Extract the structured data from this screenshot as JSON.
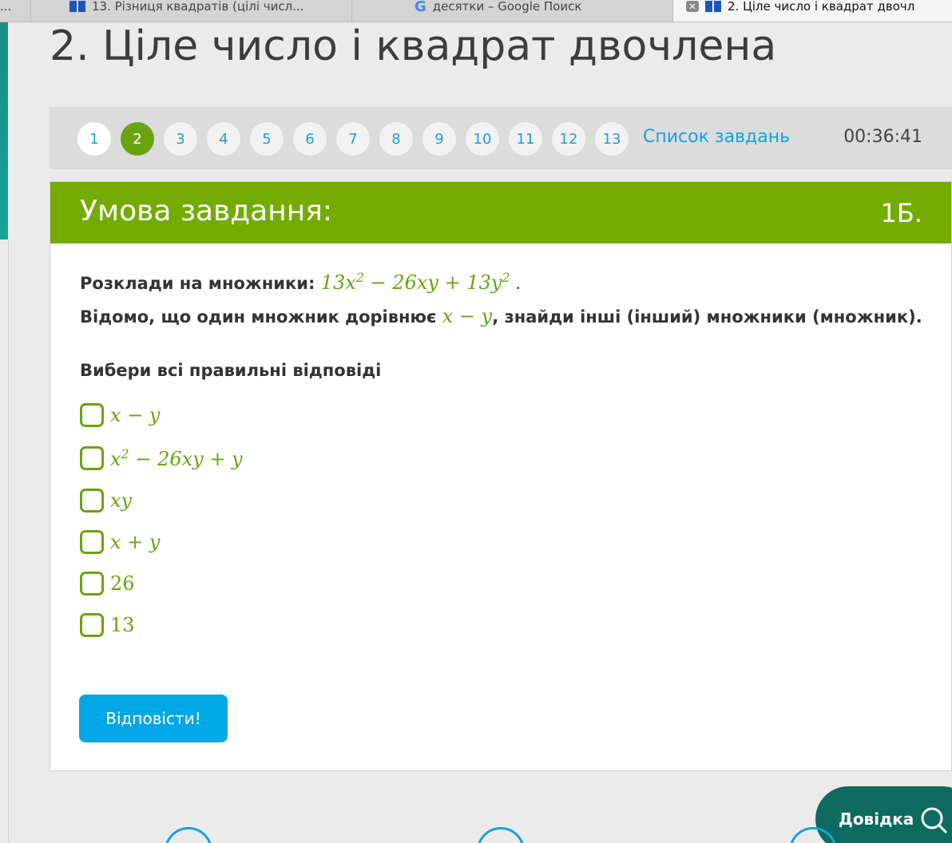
{
  "browser": {
    "tabs": [
      {
        "label": "..."
      },
      {
        "label": "13. Різниця квадратів (цілі числ..."
      },
      {
        "label": "десятки – Google Поиск",
        "icon_label": "G"
      },
      {
        "label": "2. Ціле число і квадрат двочл",
        "close_label": "✕"
      }
    ]
  },
  "page": {
    "title": "2. Ціле число і квадрат двочлена"
  },
  "nav": {
    "numbers": [
      "1",
      "2",
      "3",
      "4",
      "5",
      "6",
      "7",
      "8",
      "9",
      "10",
      "11",
      "12",
      "13"
    ],
    "active": "2",
    "task_list_label": "Список завдань",
    "timer": "00:36:41"
  },
  "task": {
    "header": "Умова завдання:",
    "points": "1Б.",
    "q1_text": "Розклади на множники: ",
    "q1_expr_part1": "13x",
    "q1_sup1": "2",
    "q1_expr_part2": " − 26xy + 13y",
    "q1_sup2": "2",
    "q1_end": " .",
    "q2_text": "Відомо, що один множник дорівнює ",
    "q2_expr": "x − y",
    "q2_end": ", знайди інші (інший) множники (множник).",
    "prompt": "Вибери всі правильні відповіді",
    "options": [
      {
        "text": "x − y"
      },
      {
        "text_part1": "x",
        "sup": "2",
        "text_part2": " − 26xy + y"
      },
      {
        "text": "xy"
      },
      {
        "text": "x + y"
      },
      {
        "text": "26"
      },
      {
        "text": "13"
      }
    ],
    "answer_button": "Відповісти!"
  },
  "help": {
    "label": "Довідка"
  },
  "colors": {
    "green": "#74ab00",
    "blue": "#00a7e6",
    "teal": "#0c6b5e"
  }
}
